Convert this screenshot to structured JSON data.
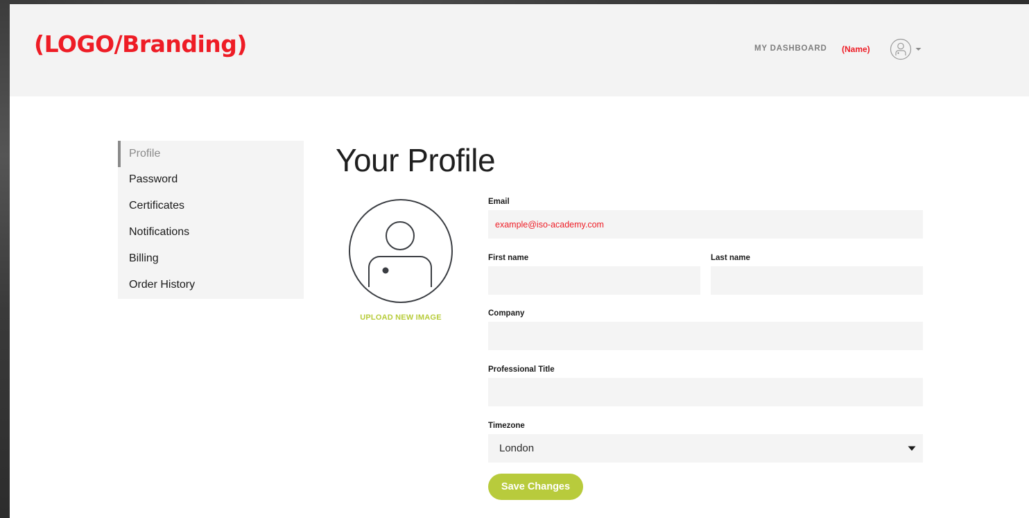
{
  "header": {
    "logo_text": "(LOGO/Branding)",
    "dashboard_link": "MY DASHBOARD",
    "user_name": "(Name)"
  },
  "sidebar": {
    "items": [
      {
        "label": "Profile",
        "active": true
      },
      {
        "label": "Password",
        "active": false
      },
      {
        "label": "Certificates",
        "active": false
      },
      {
        "label": "Notifications",
        "active": false
      },
      {
        "label": "Billing",
        "active": false
      },
      {
        "label": "Order History",
        "active": false
      }
    ]
  },
  "main": {
    "title": "Your Profile",
    "upload_label": "UPLOAD NEW IMAGE",
    "email": {
      "label": "Email",
      "value": "example@iso-academy.com"
    },
    "first_name": {
      "label": "First name",
      "value": ""
    },
    "last_name": {
      "label": "Last name",
      "value": ""
    },
    "company": {
      "label": "Company",
      "value": ""
    },
    "professional_title": {
      "label": "Professional Title",
      "value": ""
    },
    "timezone": {
      "label": "Timezone",
      "value": "London"
    },
    "save_label": "Save Changes"
  },
  "icons": {
    "avatar": "user-circle-icon",
    "dropdown": "chevron-down-icon"
  },
  "colors": {
    "brand_red": "#ee1c25",
    "accent_green": "#b8cb3c",
    "header_bg": "#f3f3f3",
    "input_bg": "#f4f4f4"
  }
}
